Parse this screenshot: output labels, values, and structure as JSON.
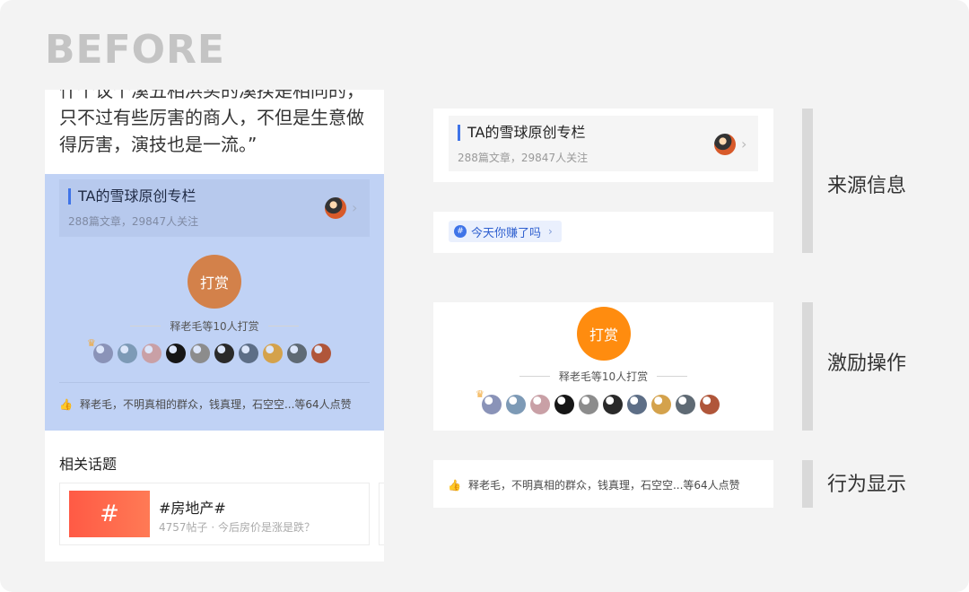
{
  "header": {
    "title": "BEFORE"
  },
  "article": {
    "lines": [
      "什个议个溪五相浜买的溪揆是相同的，",
      "只不过有些厉害的商人，不但是生意做",
      "得厉害，演技也是一流。”"
    ]
  },
  "source": {
    "title": "TA的雪球原创专栏",
    "subtitle": "288篇文章，29847人关注",
    "chevron": "›",
    "avatar_icon": "panda-avatar-icon"
  },
  "topic_tag": {
    "label": "今天你赚了吗",
    "icon": "#",
    "chevron": "›"
  },
  "tip": {
    "button_label": "打赏",
    "summary": "释老毛等10人打赏"
  },
  "avatars": [
    {
      "color": "#8a93b8"
    },
    {
      "color": "#7d9ab6"
    },
    {
      "color": "#c9a0a6"
    },
    {
      "color": "#161616"
    },
    {
      "color": "#8c8c8c"
    },
    {
      "color": "#2a2a2a"
    },
    {
      "color": "#5d6e86"
    },
    {
      "color": "#d4a24c"
    },
    {
      "color": "#5f6a74"
    },
    {
      "color": "#b0563a"
    }
  ],
  "likes": {
    "text": "释老毛，不明真相的群众，钱真理，石空空...等64人点赞",
    "icon": "thumbs-up-icon"
  },
  "topics": {
    "heading": "相关话题",
    "items": [
      {
        "thumb_label": "#",
        "name": "#房地产#",
        "meta": "4757帖子 · 今后房价是涨是跌？"
      }
    ]
  },
  "labels": {
    "source_info": "来源信息",
    "incentive": "激励操作",
    "behavior": "行为显示"
  },
  "colors": {
    "highlight": "#c0d2f5",
    "accent_blue": "#3f74e8",
    "tip_orange": "#ff8c0f",
    "tip_muted": "#d3814a",
    "topic_red": "#ff5a45"
  }
}
